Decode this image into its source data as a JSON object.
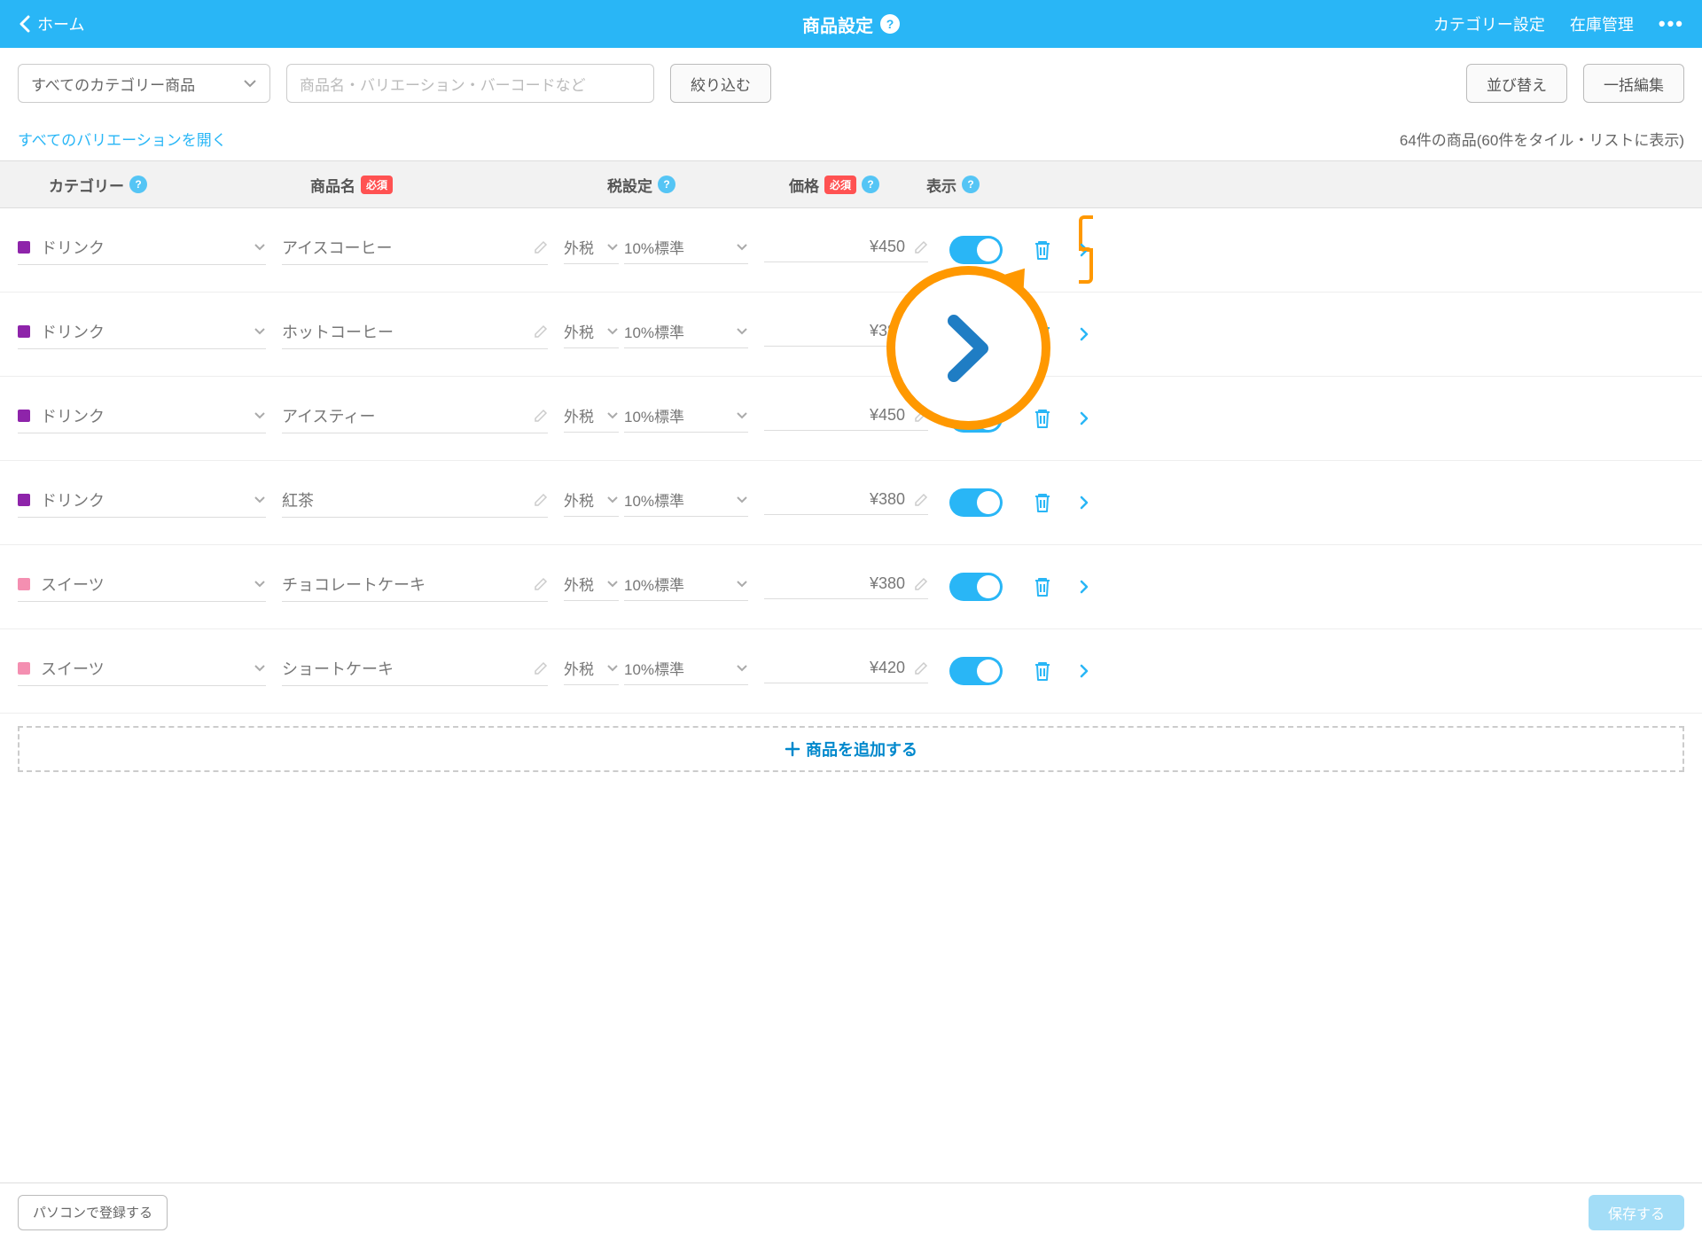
{
  "header": {
    "back_label": "ホーム",
    "title": "商品設定",
    "category_settings": "カテゴリー設定",
    "inventory": "在庫管理"
  },
  "filter": {
    "category_select": "すべてのカテゴリー商品",
    "search_placeholder": "商品名・バリエーション・バーコードなど",
    "filter_btn": "絞り込む",
    "sort_btn": "並び替え",
    "bulk_btn": "一括編集"
  },
  "subrow": {
    "expand_all": "すべてのバリエーションを開く",
    "count": "64件の商品(60件をタイル・リストに表示)"
  },
  "columns": {
    "category": "カテゴリー",
    "name": "商品名",
    "tax": "税設定",
    "price": "価格",
    "display": "表示",
    "required": "必須"
  },
  "rows": [
    {
      "category": "ドリンク",
      "cat_color": "#8e24aa",
      "name": "アイスコーヒー",
      "tax1": "外税",
      "tax2": "10%標準",
      "price": "¥450"
    },
    {
      "category": "ドリンク",
      "cat_color": "#8e24aa",
      "name": "ホットコーヒー",
      "tax1": "外税",
      "tax2": "10%標準",
      "price": "¥380"
    },
    {
      "category": "ドリンク",
      "cat_color": "#8e24aa",
      "name": "アイスティー",
      "tax1": "外税",
      "tax2": "10%標準",
      "price": "¥450"
    },
    {
      "category": "ドリンク",
      "cat_color": "#8e24aa",
      "name": "紅茶",
      "tax1": "外税",
      "tax2": "10%標準",
      "price": "¥380"
    },
    {
      "category": "スイーツ",
      "cat_color": "#f48fb1",
      "name": "チョコレートケーキ",
      "tax1": "外税",
      "tax2": "10%標準",
      "price": "¥380"
    },
    {
      "category": "スイーツ",
      "cat_color": "#f48fb1",
      "name": "ショートケーキ",
      "tax1": "外税",
      "tax2": "10%標準",
      "price": "¥420"
    }
  ],
  "add_row": "商品を追加する",
  "footer": {
    "pc_register": "パソコンで登録する",
    "save": "保存する"
  }
}
